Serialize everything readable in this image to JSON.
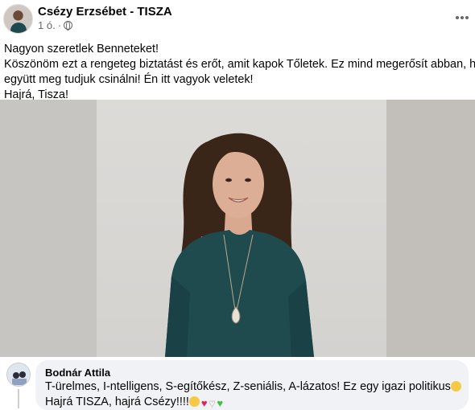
{
  "post": {
    "author": "Csézy Erzsébet - TISZA",
    "time": "1 ó.",
    "privacy_icon": "globe-icon",
    "menu_icon": "more-horizontal-icon",
    "text_lines": [
      "Nagyon szeretlek Benneteket!",
      "Köszönöm ezt a rengeteg biztatást és erőt, amit kapok Tőletek. Ez mind megerősít abban, hogy",
      "együtt meg tudjuk csinálni! Én itt vagyok veletek!",
      "Hajrá, Tisza!"
    ]
  },
  "comment": {
    "author": "Bodnár Attila",
    "line1": "T-ürelmes, I-ntelligens, S-egítőkész, Z-seniális, A-lázatos! Ez egy igazi politikus",
    "line2": "Hajrá TISZA, hajrá Csézy!!!!",
    "emojis": [
      "thinking-face",
      "grinning-face",
      "red-heart",
      "white-heart",
      "green-heart"
    ]
  },
  "colors": {
    "text_primary": "#050505",
    "text_secondary": "#65676b",
    "comment_bubble": "#f0f2f5",
    "dress": "#1f4a4e",
    "hair": "#3a2519"
  }
}
